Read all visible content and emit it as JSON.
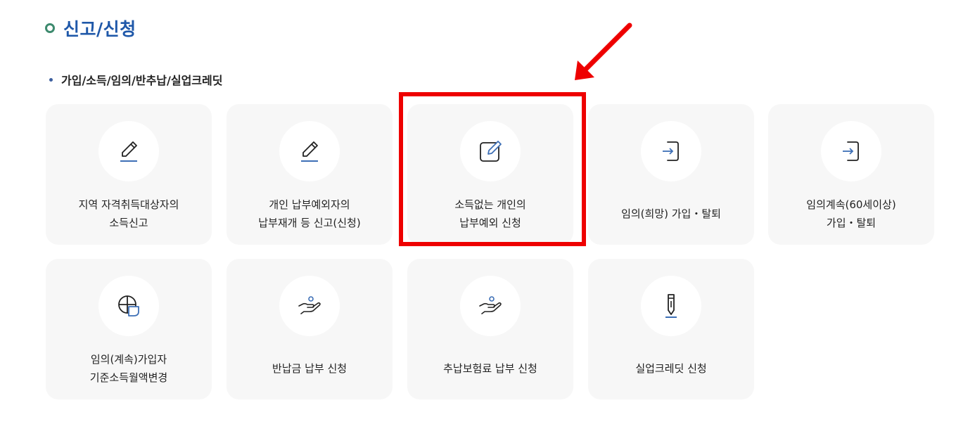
{
  "section": {
    "title": "신고/신청"
  },
  "subsection": {
    "title": "가입/소득/임의/반추납/실업크레딧"
  },
  "cards": [
    {
      "line1": "지역 자격취득대상자의",
      "line2": "소득신고",
      "icon": "pencil-icon"
    },
    {
      "line1": "개인 납부예외자의",
      "line2": "납부재개 등 신고(신청)",
      "icon": "pencil-icon"
    },
    {
      "line1": "소득없는 개인의",
      "line2": "납부예외 신청",
      "icon": "edit-document-icon"
    },
    {
      "line1": "임의(희망) 가입・탈퇴",
      "line2": "",
      "icon": "sign-in-icon"
    },
    {
      "line1": "임의계속(60세이상)",
      "line2": "가입・탈퇴",
      "icon": "sign-in-icon"
    },
    {
      "line1": "임의(계속)가입자",
      "line2": "기준소득월액변경",
      "icon": "chart-change-icon"
    },
    {
      "line1": "반납금 납부 신청",
      "line2": "",
      "icon": "hand-coin-icon"
    },
    {
      "line1": "추납보험료 납부 신청",
      "line2": "",
      "icon": "hand-coin-icon"
    },
    {
      "line1": "실업크레딧 신청",
      "line2": "",
      "icon": "pen-icon"
    }
  ],
  "annotation": {
    "highlighted_card": "소득없는 개인의 납부예외 신청",
    "color": "#ee0000"
  },
  "colors": {
    "title": "#1f58a9",
    "accent_green": "#3d8a6e",
    "icon_blue": "#3d6fb6",
    "card_bg": "#f7f7f7"
  }
}
